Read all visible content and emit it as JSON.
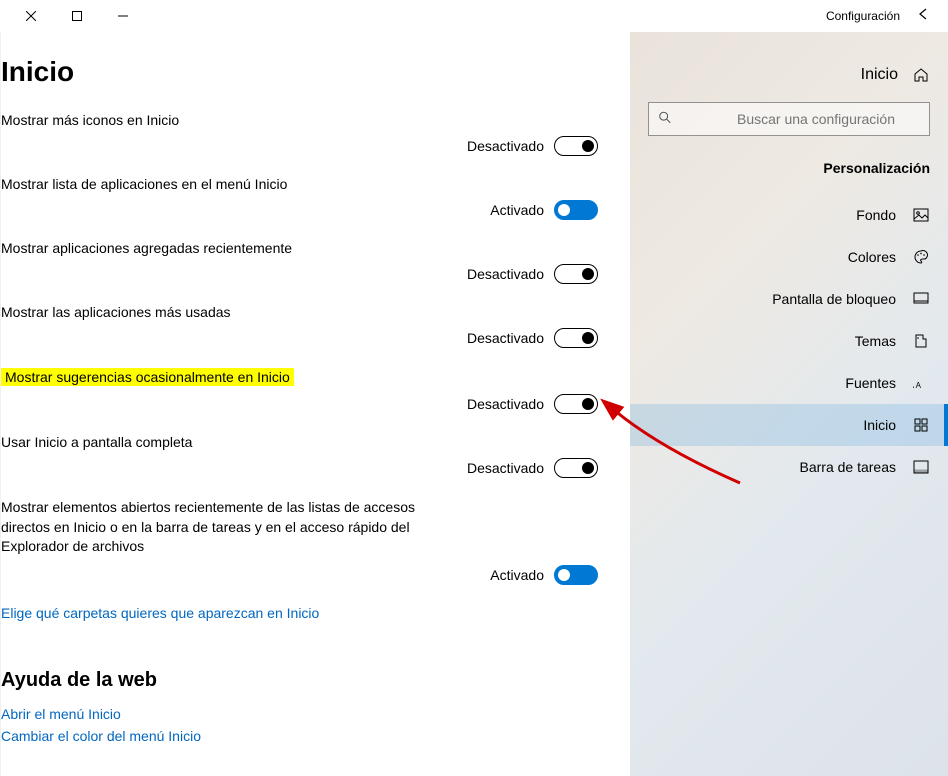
{
  "titlebar": {
    "app_name": "Configuración"
  },
  "sidebar": {
    "home_label": "Inicio",
    "search_placeholder": "Buscar una configuración",
    "section": "Personalización",
    "items": [
      {
        "label": "Fondo"
      },
      {
        "label": "Colores"
      },
      {
        "label": "Pantalla de bloqueo"
      },
      {
        "label": "Temas"
      },
      {
        "label": "Fuentes"
      },
      {
        "label": "Inicio"
      },
      {
        "label": "Barra de tareas"
      }
    ]
  },
  "page": {
    "title": "Inicio",
    "settings": [
      {
        "label": "Mostrar más iconos en Inicio",
        "state": "Desactivado",
        "on": false
      },
      {
        "label": "Mostrar lista de aplicaciones en el menú Inicio",
        "state": "Activado",
        "on": true
      },
      {
        "label": "Mostrar aplicaciones agregadas recientemente",
        "state": "Desactivado",
        "on": false
      },
      {
        "label": "Mostrar las aplicaciones más usadas",
        "state": "Desactivado",
        "on": false
      },
      {
        "label": "Mostrar sugerencias ocasionalmente en Inicio",
        "state": "Desactivado",
        "on": false,
        "highlight": true
      },
      {
        "label": "Usar Inicio a pantalla completa",
        "state": "Desactivado",
        "on": false
      },
      {
        "label": "Mostrar elementos abiertos recientemente de las listas de accesos directos en Inicio o en la barra de tareas y en el acceso rápido del Explorador de archivos",
        "state": "Activado",
        "on": true,
        "multiline": true
      }
    ],
    "folder_link": "Elige qué carpetas quieres que aparezcan en Inicio",
    "help": {
      "title": "Ayuda de la web",
      "links": [
        "Abrir el menú Inicio",
        "Cambiar el color del menú Inicio"
      ]
    }
  }
}
